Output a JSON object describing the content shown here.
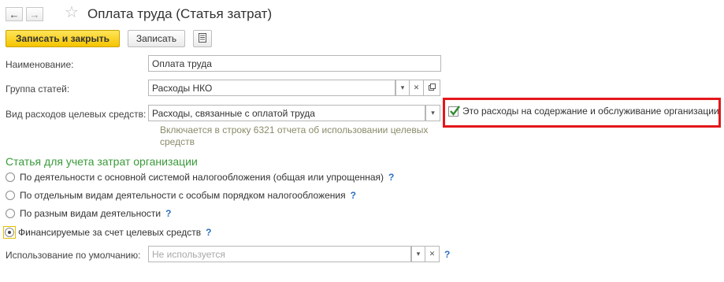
{
  "title": "Оплата труда (Статья затрат)",
  "nav": {
    "back_icon": "←",
    "forward_icon": "→",
    "favorite_icon": "☆"
  },
  "toolbar": {
    "save_close_label": "Записать и закрыть",
    "save_label": "Записать",
    "report_icon": "list-icon"
  },
  "form": {
    "name_label": "Наименование:",
    "name_value": "Оплата труда",
    "group_label": "Группа статей:",
    "group_value": "Расходы НКО",
    "expense_type_label": "Вид расходов целевых средств:",
    "expense_type_value": "Расходы, связанные с оплатой труда",
    "hint_line1": "Включается в строку 6321 отчета об использовании целевых",
    "hint_line2": "средств",
    "maintenance_checkbox_label": "Это расходы на содержание и обслуживание организации",
    "maintenance_checked": true
  },
  "section": {
    "title": "Статья для учета затрат организации",
    "options": [
      {
        "label": "По деятельности с основной системой налогообложения (общая или упрощенная)",
        "selected": false
      },
      {
        "label": "По отдельным видам деятельности с особым порядком налогообложения",
        "selected": false
      },
      {
        "label": "По разным видам деятельности",
        "selected": false
      },
      {
        "label": "Финансируемые за счет целевых средств",
        "selected": true
      }
    ],
    "help_mark": "?"
  },
  "default_usage": {
    "label": "Использование по умолчанию:",
    "placeholder": "Не используется"
  },
  "colors": {
    "accent_yellow": "#f5c400",
    "section_green": "#3a9a3a",
    "highlight_red": "#e3171b",
    "help_blue": "#2a6fbf"
  }
}
